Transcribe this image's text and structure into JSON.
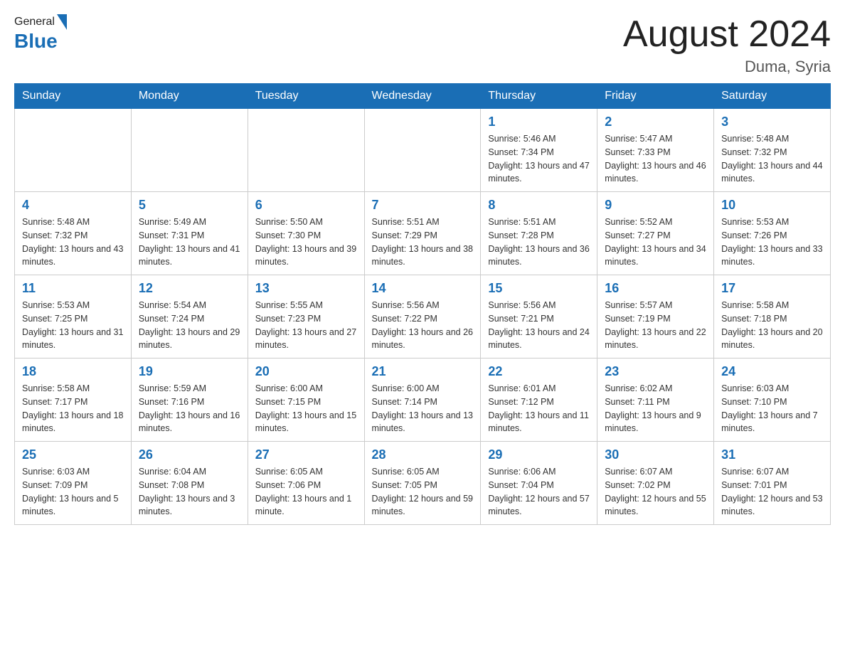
{
  "header": {
    "logo_general": "General",
    "logo_blue": "Blue",
    "month_year": "August 2024",
    "location": "Duma, Syria"
  },
  "days_of_week": [
    "Sunday",
    "Monday",
    "Tuesday",
    "Wednesday",
    "Thursday",
    "Friday",
    "Saturday"
  ],
  "weeks": [
    [
      {
        "day": "",
        "info": ""
      },
      {
        "day": "",
        "info": ""
      },
      {
        "day": "",
        "info": ""
      },
      {
        "day": "",
        "info": ""
      },
      {
        "day": "1",
        "info": "Sunrise: 5:46 AM\nSunset: 7:34 PM\nDaylight: 13 hours and 47 minutes."
      },
      {
        "day": "2",
        "info": "Sunrise: 5:47 AM\nSunset: 7:33 PM\nDaylight: 13 hours and 46 minutes."
      },
      {
        "day": "3",
        "info": "Sunrise: 5:48 AM\nSunset: 7:32 PM\nDaylight: 13 hours and 44 minutes."
      }
    ],
    [
      {
        "day": "4",
        "info": "Sunrise: 5:48 AM\nSunset: 7:32 PM\nDaylight: 13 hours and 43 minutes."
      },
      {
        "day": "5",
        "info": "Sunrise: 5:49 AM\nSunset: 7:31 PM\nDaylight: 13 hours and 41 minutes."
      },
      {
        "day": "6",
        "info": "Sunrise: 5:50 AM\nSunset: 7:30 PM\nDaylight: 13 hours and 39 minutes."
      },
      {
        "day": "7",
        "info": "Sunrise: 5:51 AM\nSunset: 7:29 PM\nDaylight: 13 hours and 38 minutes."
      },
      {
        "day": "8",
        "info": "Sunrise: 5:51 AM\nSunset: 7:28 PM\nDaylight: 13 hours and 36 minutes."
      },
      {
        "day": "9",
        "info": "Sunrise: 5:52 AM\nSunset: 7:27 PM\nDaylight: 13 hours and 34 minutes."
      },
      {
        "day": "10",
        "info": "Sunrise: 5:53 AM\nSunset: 7:26 PM\nDaylight: 13 hours and 33 minutes."
      }
    ],
    [
      {
        "day": "11",
        "info": "Sunrise: 5:53 AM\nSunset: 7:25 PM\nDaylight: 13 hours and 31 minutes."
      },
      {
        "day": "12",
        "info": "Sunrise: 5:54 AM\nSunset: 7:24 PM\nDaylight: 13 hours and 29 minutes."
      },
      {
        "day": "13",
        "info": "Sunrise: 5:55 AM\nSunset: 7:23 PM\nDaylight: 13 hours and 27 minutes."
      },
      {
        "day": "14",
        "info": "Sunrise: 5:56 AM\nSunset: 7:22 PM\nDaylight: 13 hours and 26 minutes."
      },
      {
        "day": "15",
        "info": "Sunrise: 5:56 AM\nSunset: 7:21 PM\nDaylight: 13 hours and 24 minutes."
      },
      {
        "day": "16",
        "info": "Sunrise: 5:57 AM\nSunset: 7:19 PM\nDaylight: 13 hours and 22 minutes."
      },
      {
        "day": "17",
        "info": "Sunrise: 5:58 AM\nSunset: 7:18 PM\nDaylight: 13 hours and 20 minutes."
      }
    ],
    [
      {
        "day": "18",
        "info": "Sunrise: 5:58 AM\nSunset: 7:17 PM\nDaylight: 13 hours and 18 minutes."
      },
      {
        "day": "19",
        "info": "Sunrise: 5:59 AM\nSunset: 7:16 PM\nDaylight: 13 hours and 16 minutes."
      },
      {
        "day": "20",
        "info": "Sunrise: 6:00 AM\nSunset: 7:15 PM\nDaylight: 13 hours and 15 minutes."
      },
      {
        "day": "21",
        "info": "Sunrise: 6:00 AM\nSunset: 7:14 PM\nDaylight: 13 hours and 13 minutes."
      },
      {
        "day": "22",
        "info": "Sunrise: 6:01 AM\nSunset: 7:12 PM\nDaylight: 13 hours and 11 minutes."
      },
      {
        "day": "23",
        "info": "Sunrise: 6:02 AM\nSunset: 7:11 PM\nDaylight: 13 hours and 9 minutes."
      },
      {
        "day": "24",
        "info": "Sunrise: 6:03 AM\nSunset: 7:10 PM\nDaylight: 13 hours and 7 minutes."
      }
    ],
    [
      {
        "day": "25",
        "info": "Sunrise: 6:03 AM\nSunset: 7:09 PM\nDaylight: 13 hours and 5 minutes."
      },
      {
        "day": "26",
        "info": "Sunrise: 6:04 AM\nSunset: 7:08 PM\nDaylight: 13 hours and 3 minutes."
      },
      {
        "day": "27",
        "info": "Sunrise: 6:05 AM\nSunset: 7:06 PM\nDaylight: 13 hours and 1 minute."
      },
      {
        "day": "28",
        "info": "Sunrise: 6:05 AM\nSunset: 7:05 PM\nDaylight: 12 hours and 59 minutes."
      },
      {
        "day": "29",
        "info": "Sunrise: 6:06 AM\nSunset: 7:04 PM\nDaylight: 12 hours and 57 minutes."
      },
      {
        "day": "30",
        "info": "Sunrise: 6:07 AM\nSunset: 7:02 PM\nDaylight: 12 hours and 55 minutes."
      },
      {
        "day": "31",
        "info": "Sunrise: 6:07 AM\nSunset: 7:01 PM\nDaylight: 12 hours and 53 minutes."
      }
    ]
  ]
}
